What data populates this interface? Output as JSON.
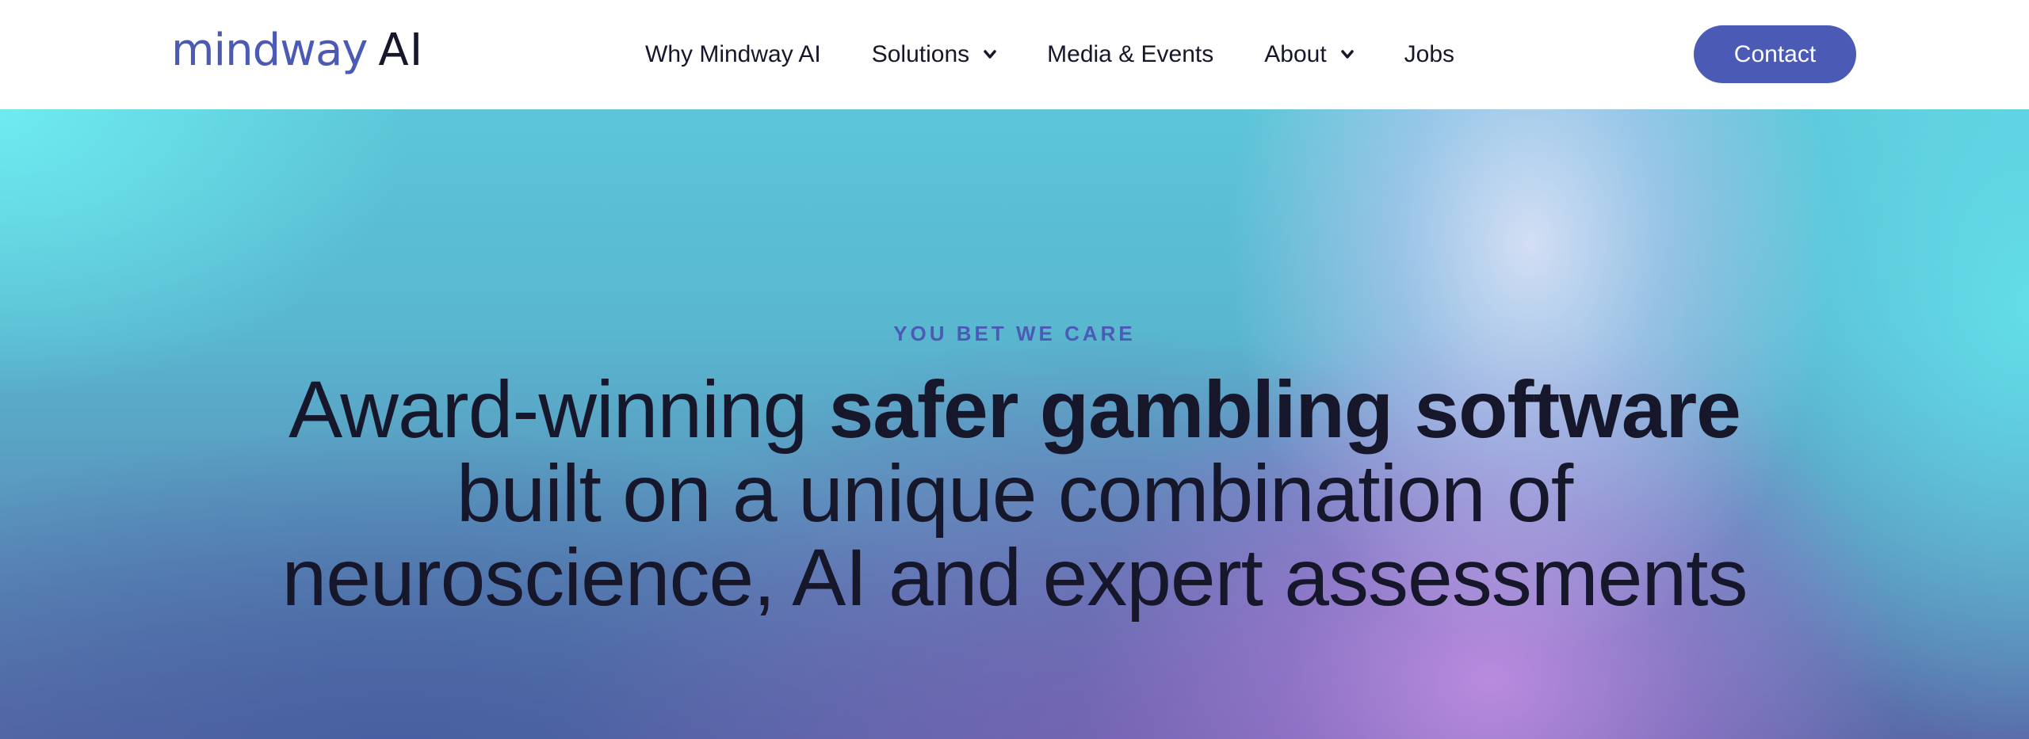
{
  "brand": {
    "word": "mindway",
    "suffix": "AI",
    "primary_color": "#4b5ab5",
    "text_color": "#17172b"
  },
  "nav": {
    "items": [
      {
        "label": "Why Mindway AI",
        "has_dropdown": false
      },
      {
        "label": "Solutions",
        "has_dropdown": true
      },
      {
        "label": "Media & Events",
        "has_dropdown": false
      },
      {
        "label": "About",
        "has_dropdown": true
      },
      {
        "label": "Jobs",
        "has_dropdown": false
      }
    ],
    "dropdown_icon": "chevron-down-icon"
  },
  "contact": {
    "label": "Contact"
  },
  "hero": {
    "eyebrow": "YOU BET WE CARE",
    "headline_regular_1": "Award-winning ",
    "headline_bold": "safer gambling software",
    "headline_line_2": "built on a unique combination of",
    "headline_line_3": "neuroscience, AI and expert assessments"
  }
}
